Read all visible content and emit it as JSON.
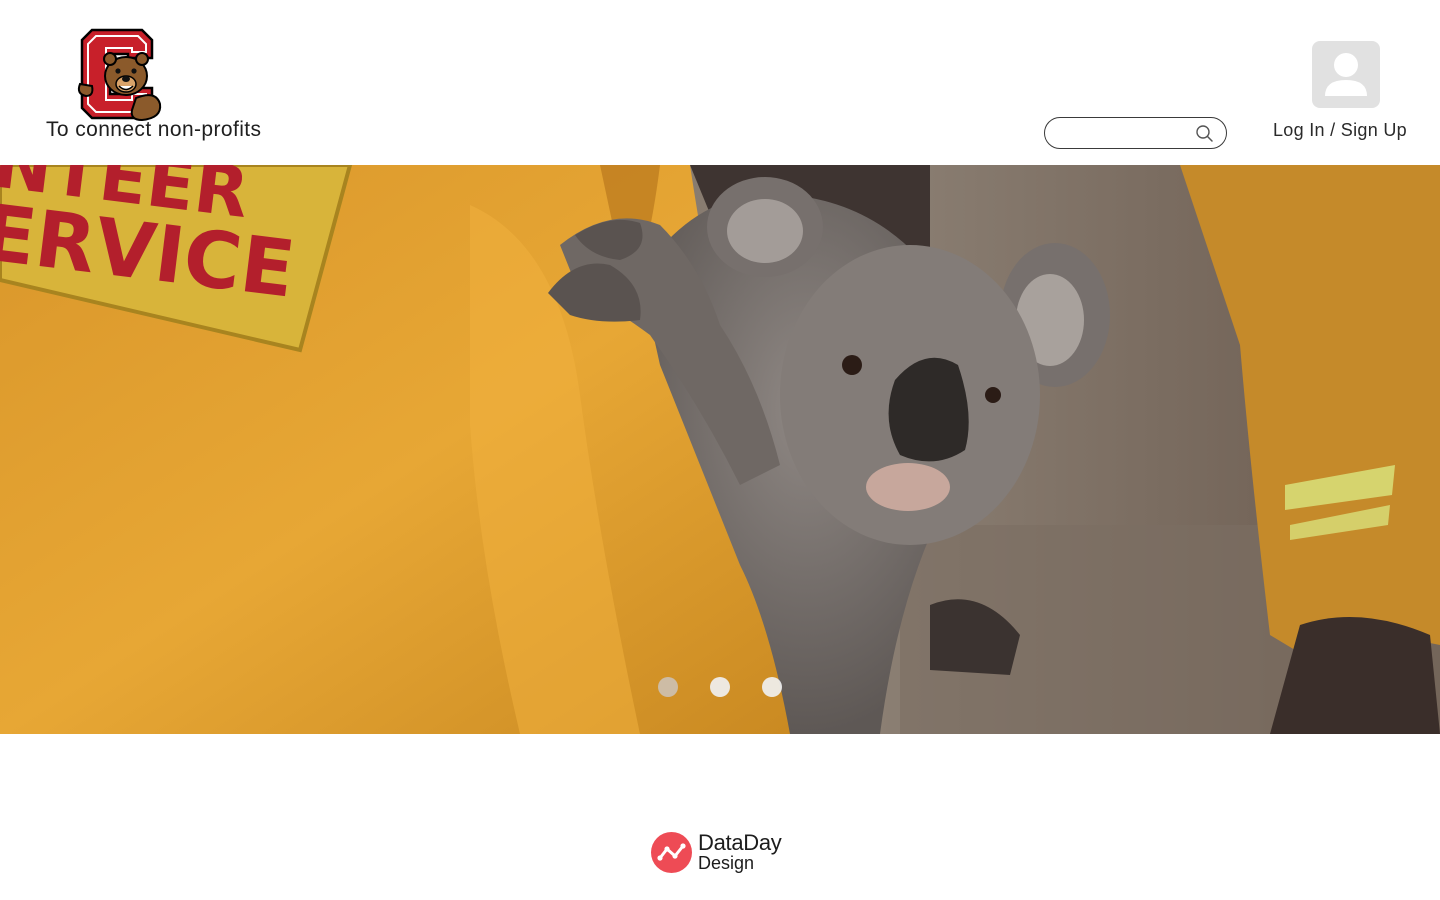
{
  "header": {
    "tagline": "To connect non-profits",
    "search": {
      "placeholder": "",
      "value": ""
    },
    "auth": {
      "login_label": "Log In",
      "separator": "/",
      "signup_label": "Sign Up"
    },
    "logo_icon": "bear-c-logo-icon",
    "avatar_icon": "user-avatar-icon"
  },
  "hero": {
    "image_text": "ERVICE",
    "carousel": {
      "count": 3,
      "active_index": 0
    }
  },
  "footer": {
    "brand_line1": "DataDay",
    "brand_line2": "Design",
    "brand_icon": "dataday-logo-icon",
    "brand_color": "#ee4b55"
  },
  "colors": {
    "jacket": "#e6a32c",
    "patch": "#d8b43a",
    "patch_text": "#b31f2c",
    "koala": "#7c7572",
    "background_haze": "#8a7d71"
  }
}
